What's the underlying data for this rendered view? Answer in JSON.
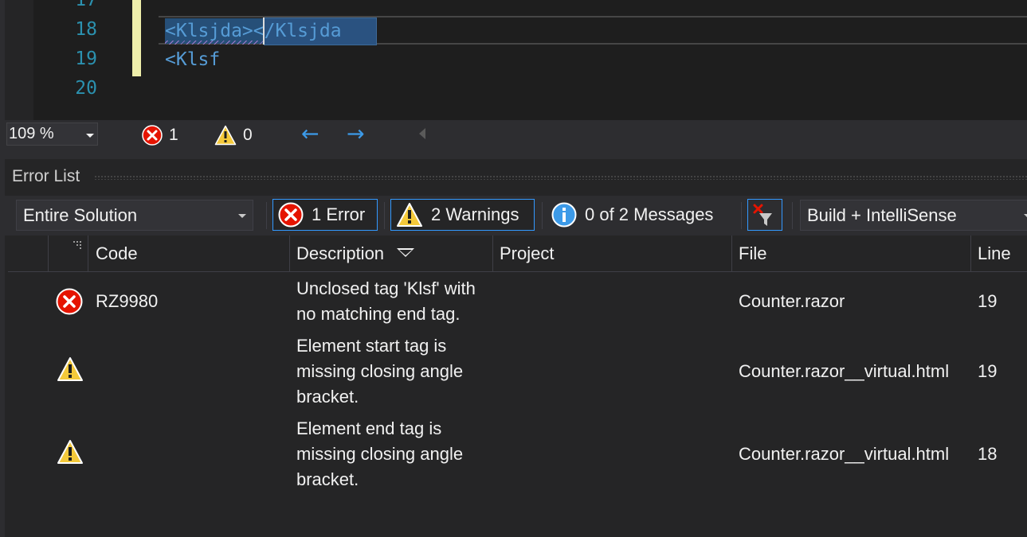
{
  "editor": {
    "line_numbers": [
      "17",
      "18",
      "19",
      "20"
    ],
    "line18_tag1": "<Klsjda>",
    "line18_tag2": "</Klsjda",
    "line19_code": "<Klsf"
  },
  "status_bar": {
    "zoom": "109 %",
    "error_count": "1",
    "warning_count": "0",
    "nav_back": "←",
    "nav_forward": "→"
  },
  "error_list": {
    "title": "Error List",
    "scope": "Entire Solution",
    "errors_filter": "1 Error",
    "warnings_filter": "2 Warnings",
    "messages_filter": "0 of 2 Messages",
    "source": "Build + IntelliSense",
    "columns": {
      "code": "Code",
      "description": "Description",
      "project": "Project",
      "file": "File",
      "line": "Line"
    },
    "rows": [
      {
        "severity": "error",
        "code": "RZ9980",
        "description": "Unclosed tag 'Klsf' with no matching end tag.",
        "project": "",
        "file": "Counter.razor",
        "line": "19"
      },
      {
        "severity": "warning",
        "code": "",
        "description": "Element start tag is missing closing angle bracket.",
        "project": "",
        "file": "Counter.razor__virtual.html",
        "line": "19"
      },
      {
        "severity": "warning",
        "code": "",
        "description": "Element end tag is missing closing angle bracket.",
        "project": "",
        "file": "Counter.razor__virtual.html",
        "line": "18"
      }
    ]
  },
  "colors": {
    "error": "#e51400",
    "warning": "#f4c93a",
    "info": "#3c9ae8",
    "accent": "#3399ff"
  },
  "icons": [
    "error-icon",
    "warning-icon",
    "info-icon",
    "clear-filter-icon",
    "arrow-left-icon",
    "arrow-right-icon",
    "chevron-down-icon"
  ]
}
